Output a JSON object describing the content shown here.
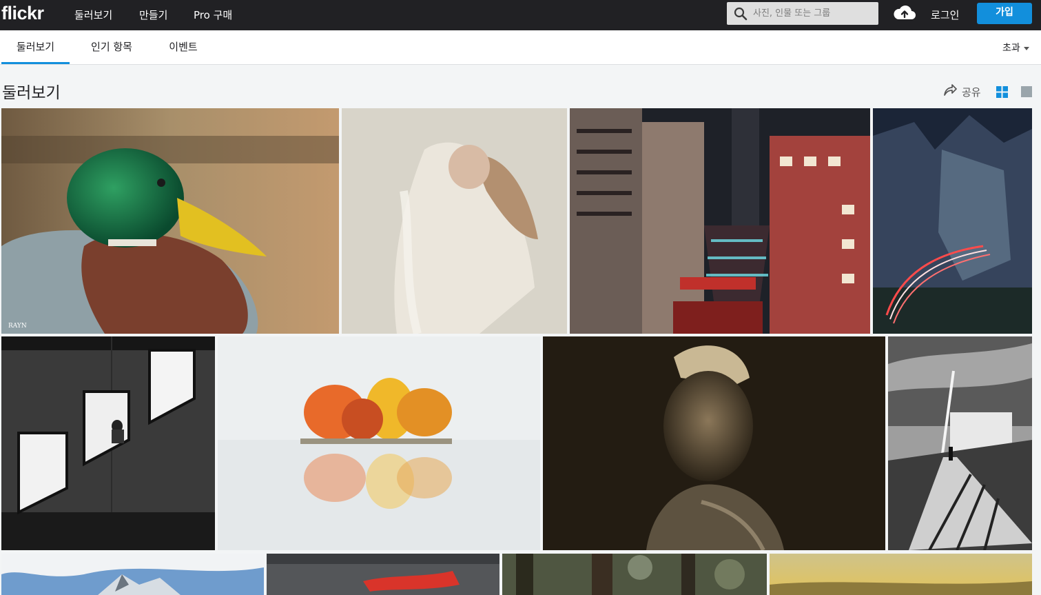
{
  "header": {
    "logo": "flickr",
    "nav": [
      "둘러보기",
      "만들기",
      "Pro 구매"
    ],
    "search_placeholder": "사진, 인물 또는 그룹",
    "login_label": "로그인",
    "signup_label": "가입",
    "accent_color": "#128fdc"
  },
  "subnav": {
    "tabs": [
      {
        "label": "둘러보기",
        "active": true
      },
      {
        "label": "인기 항목",
        "active": false
      },
      {
        "label": "이벤트",
        "active": false
      }
    ],
    "more_label": "초과"
  },
  "main": {
    "title": "둘러보기",
    "share_label": "공유",
    "view_modes": [
      "grid-view",
      "single-view"
    ]
  },
  "photos": [
    {
      "name": "photo-mallard-duck",
      "watermark": "RAYN"
    },
    {
      "name": "photo-woman-white-dress"
    },
    {
      "name": "photo-neon-city-street"
    },
    {
      "name": "photo-night-road-light-trails"
    },
    {
      "name": "photo-bw-windows"
    },
    {
      "name": "photo-autumn-island-fog"
    },
    {
      "name": "photo-sepia-portrait"
    },
    {
      "name": "photo-bw-bridge"
    },
    {
      "name": "photo-snowy-mountain"
    },
    {
      "name": "photo-red-clouds"
    },
    {
      "name": "photo-forest-bokeh"
    },
    {
      "name": "photo-golden-sky"
    }
  ]
}
